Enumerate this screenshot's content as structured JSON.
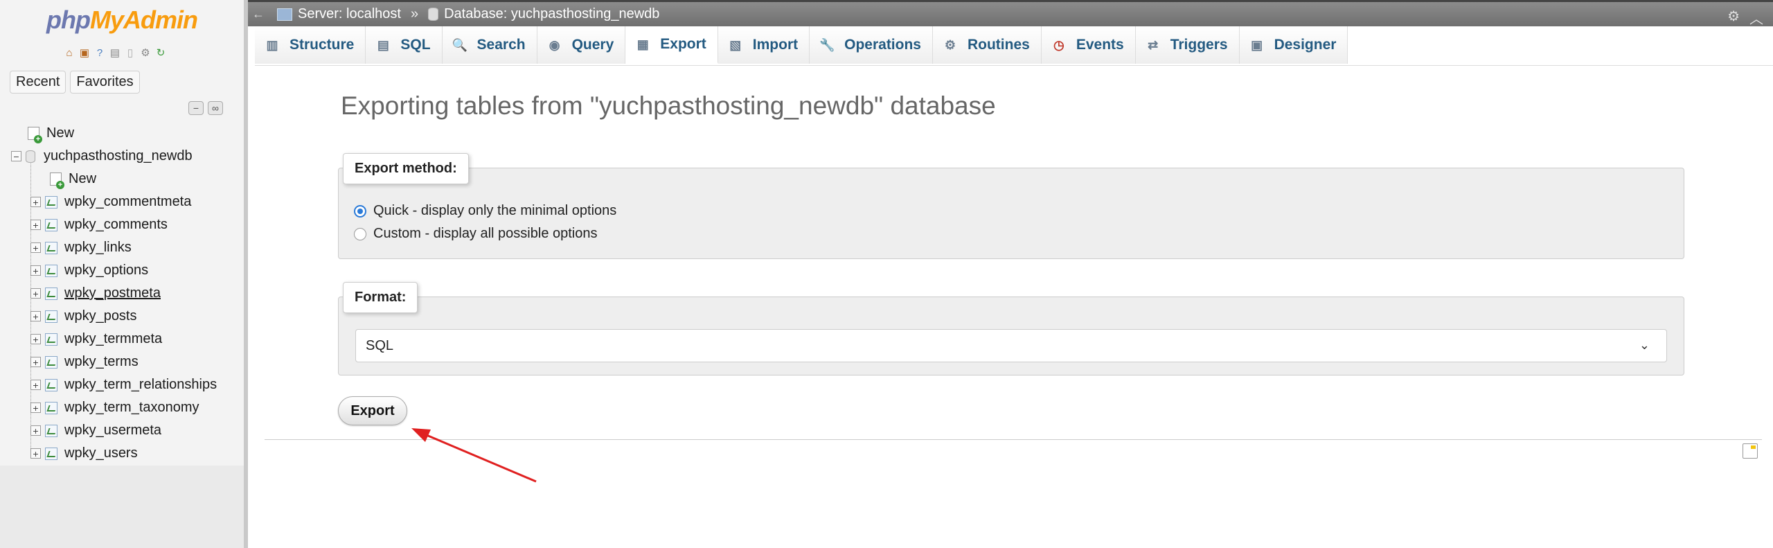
{
  "logo": {
    "php": "php",
    "myadmin": "MyAdmin"
  },
  "nav_buttons": {
    "recent": "Recent",
    "favorites": "Favorites"
  },
  "tree": {
    "new_root": "New",
    "database": "yuchpasthosting_newdb",
    "new_table": "New",
    "tables": [
      "wpky_commentmeta",
      "wpky_comments",
      "wpky_links",
      "wpky_options",
      "wpky_postmeta",
      "wpky_posts",
      "wpky_termmeta",
      "wpky_terms",
      "wpky_term_relationships",
      "wpky_term_taxonomy",
      "wpky_usermeta",
      "wpky_users"
    ]
  },
  "breadcrumb": {
    "server": "Server: localhost",
    "separator": "»",
    "database": "Database: yuchpasthosting_newdb"
  },
  "tabs": [
    {
      "label": "Structure",
      "icon": "structure-icon"
    },
    {
      "label": "SQL",
      "icon": "sql-icon"
    },
    {
      "label": "Search",
      "icon": "search-icon"
    },
    {
      "label": "Query",
      "icon": "query-icon"
    },
    {
      "label": "Export",
      "icon": "export-icon",
      "active": true
    },
    {
      "label": "Import",
      "icon": "import-icon"
    },
    {
      "label": "Operations",
      "icon": "wrench-icon"
    },
    {
      "label": "Routines",
      "icon": "routines-icon"
    },
    {
      "label": "Events",
      "icon": "clock-icon"
    },
    {
      "label": "Triggers",
      "icon": "triggers-icon"
    },
    {
      "label": "Designer",
      "icon": "designer-icon"
    }
  ],
  "main": {
    "title": "Exporting tables from \"yuchpasthosting_newdb\" database",
    "export_method": {
      "legend": "Export method:",
      "options": [
        {
          "label": "Quick - display only the minimal options",
          "checked": true
        },
        {
          "label": "Custom - display all possible options",
          "checked": false
        }
      ]
    },
    "format": {
      "legend": "Format:",
      "selected": "SQL"
    },
    "export_button": "Export"
  },
  "colors": {
    "link": "#235a81",
    "accent_arrow": "#e02020",
    "radio_checked": "#2a7ad8"
  }
}
